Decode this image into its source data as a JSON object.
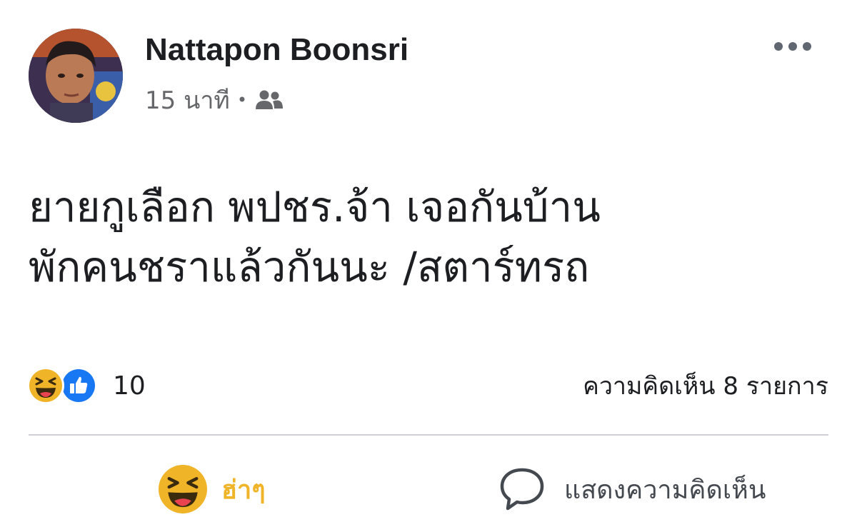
{
  "post": {
    "author": {
      "name": "Nattapon Boonsri"
    },
    "meta": {
      "time": "15 นาที",
      "separator": "•",
      "audience_icon": "friends-icon"
    },
    "more_icon": "more-horizontal-icon",
    "text_lines": [
      "ยายกูเลือก พปชร.จ้า เจอกันบ้าน",
      "พักคนชราแล้วกันนะ /สตาร์ทรถ"
    ],
    "reactions": {
      "icons": [
        "haha-reaction-icon",
        "like-reaction-icon"
      ],
      "count": "10"
    },
    "comments": {
      "count_label": "ความคิดเห็น 8 รายการ"
    },
    "actions": {
      "haha_label": "ฮ่าๆ",
      "comment_label": "แสดงความคิดเห็น"
    }
  },
  "colors": {
    "haha_yellow": "#f0b429",
    "like_blue": "#1877f2",
    "secondary_text": "#65676b",
    "primary_text": "#1c1e21",
    "divider": "#ced0d4"
  }
}
